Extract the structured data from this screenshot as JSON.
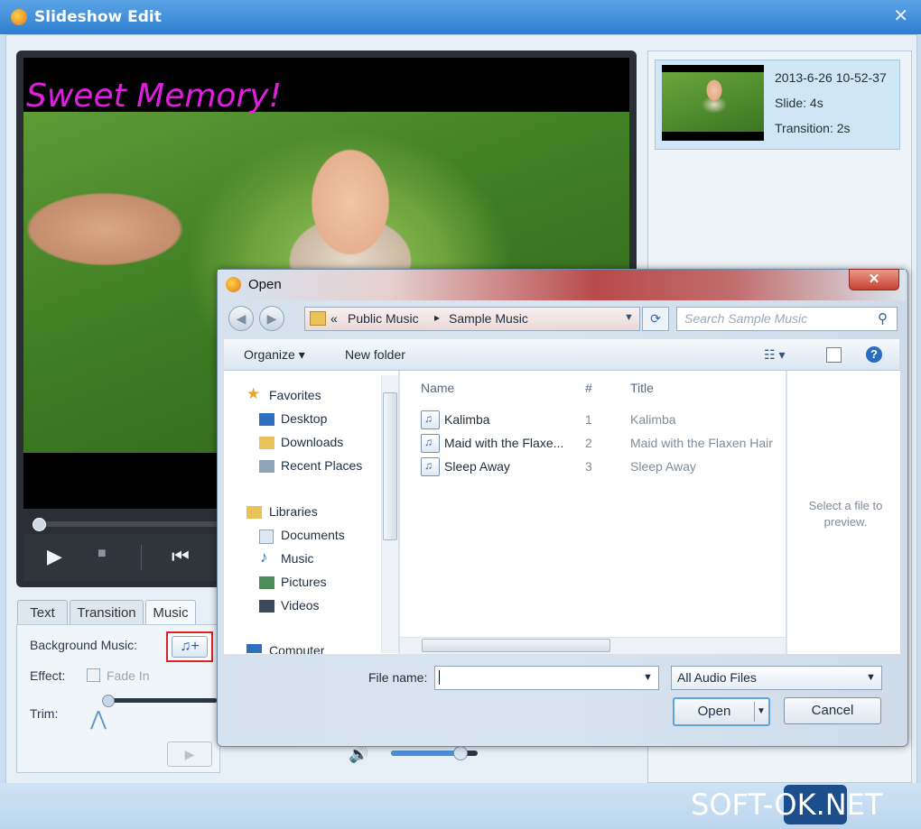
{
  "window": {
    "title": "Slideshow Edit",
    "close": "✕"
  },
  "video_overlay_text": "Sweet Memory!",
  "slide": {
    "date": "2013-6-26 10-52-37",
    "slide_duration": "Slide: 4s",
    "transition_duration": "Transition: 2s"
  },
  "playback": {
    "play": "▶",
    "stop": "■",
    "rewind": "⏮"
  },
  "tabs": [
    {
      "label": "Text"
    },
    {
      "label": "Transition"
    },
    {
      "label": "Music"
    }
  ],
  "music_panel": {
    "background_music_label": "Background Music:",
    "add_music_icon": "♫+",
    "effect_label": "Effect:",
    "fade_in_label": "Fade In",
    "trim_label": "Trim:",
    "play": "▶",
    "stop": "■"
  },
  "volume": {
    "icon": "🔊",
    "level_percent": 80
  },
  "open_dialog": {
    "title": "Open",
    "close": "✕",
    "breadcrumb": {
      "prefix": "«",
      "parts": [
        "Public Music",
        "Sample Music"
      ],
      "sep": "▸"
    },
    "search_placeholder": "Search Sample Music",
    "toolbar": {
      "organize": "Organize ▾",
      "new_folder": "New folder",
      "view_icon": "☷ ▾"
    },
    "nav": {
      "favorites": "Favorites",
      "desktop": "Desktop",
      "downloads": "Downloads",
      "recent_places": "Recent Places",
      "libraries": "Libraries",
      "documents": "Documents",
      "music": "Music",
      "pictures": "Pictures",
      "videos": "Videos",
      "computer": "Computer"
    },
    "columns": {
      "name": "Name",
      "number": "#",
      "title": "Title"
    },
    "files": [
      {
        "name": "Kalimba",
        "number": "1",
        "title": "Kalimba"
      },
      {
        "name": "Maid with the Flaxe...",
        "number": "2",
        "title": "Maid with the Flaxen Hair"
      },
      {
        "name": "Sleep Away",
        "number": "3",
        "title": "Sleep Away"
      }
    ],
    "preview_text": "Select a file to preview.",
    "file_name_label": "File name:",
    "file_name_value": "",
    "file_type": "All Audio Files",
    "open_button": "Open",
    "cancel_button": "Cancel"
  },
  "watermark": {
    "left": "SOFT-",
    "ok": "OK",
    "right": ".NET"
  },
  "colors": {
    "title_bar": "#2f7fcf",
    "overlay_text": "#e01ee0",
    "highlight_border": "#dd2222"
  }
}
